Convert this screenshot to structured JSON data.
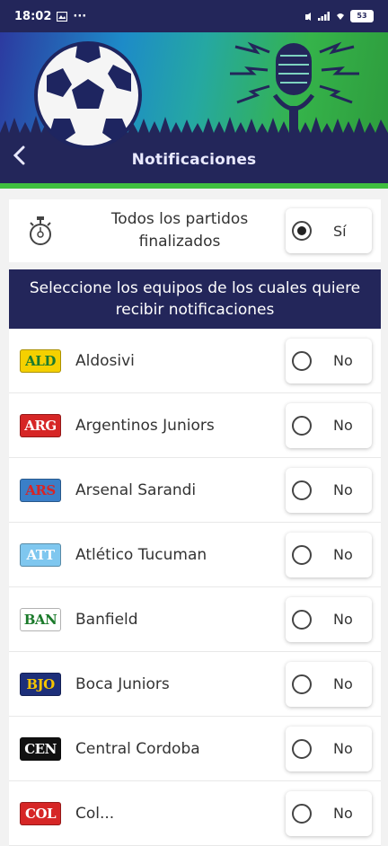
{
  "status_bar": {
    "time": "18:02",
    "dots": "···",
    "battery": "53"
  },
  "header": {
    "title": "Notificaciones"
  },
  "all_matches": {
    "label_line1": "Todos los partidos",
    "label_line2": "finalizados",
    "option": "Sí",
    "selected": true
  },
  "instruction": {
    "line1": "Seleccione los equipos de los cuales quiere",
    "line2": "recibir notificaciones"
  },
  "teams": [
    {
      "abbr": "ALD",
      "name": "Aldosivi",
      "option": "No",
      "bg": "#f5d000",
      "fg": "#1b7a2e"
    },
    {
      "abbr": "ARG",
      "name": "Argentinos Juniors",
      "option": "No",
      "bg": "#d62626",
      "fg": "#ffffff"
    },
    {
      "abbr": "ARS",
      "name": "Arsenal Sarandi",
      "option": "No",
      "bg": "#3a7fc8",
      "fg": "#d92424"
    },
    {
      "abbr": "ATT",
      "name": "Atlético Tucuman",
      "option": "No",
      "bg": "#7fc7ef",
      "fg": "#ffffff"
    },
    {
      "abbr": "BAN",
      "name": "Banfield",
      "option": "No",
      "bg": "#ffffff",
      "fg": "#1a7a2a"
    },
    {
      "abbr": "BJO",
      "name": "Boca Juniors",
      "option": "No",
      "bg": "#1d2f7a",
      "fg": "#f5c400"
    },
    {
      "abbr": "CEN",
      "name": "Central Cordoba",
      "option": "No",
      "bg": "#111111",
      "fg": "#ffffff"
    },
    {
      "abbr": "COL",
      "name": "Col...",
      "option": "No",
      "bg": "#d62626",
      "fg": "#ffffff"
    }
  ],
  "colors": {
    "navy": "#23265a",
    "background": "#f2f2f2",
    "accent_green": "#3fbf3f"
  }
}
